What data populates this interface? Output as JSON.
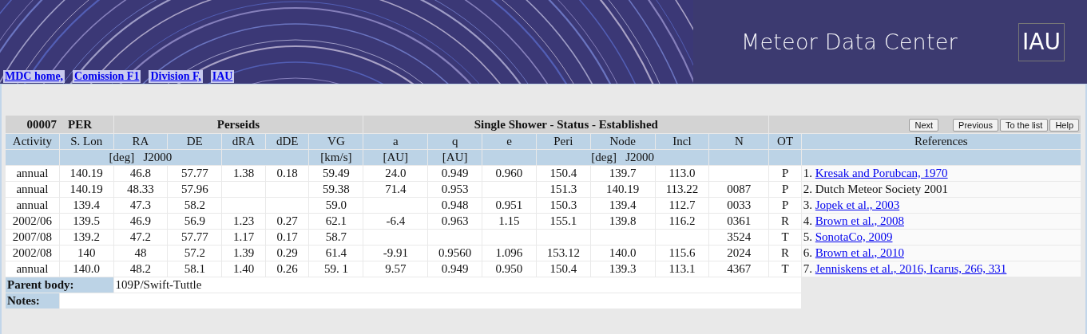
{
  "header": {
    "title": "Meteor Data Center",
    "logo": "IAU",
    "nav_links": [
      "MDC home,",
      "Comission F1",
      "Division F,",
      "IAU"
    ]
  },
  "shower": {
    "number": "00007",
    "code": "PER",
    "name": "Perseids",
    "status": "Single Shower - Status - Established"
  },
  "buttons": [
    "Next",
    "Previous",
    "To the list",
    "Help"
  ],
  "columns": [
    "Activity",
    "S. Lon",
    "RA",
    "DE",
    "dRA",
    "dDE",
    "VG",
    "a",
    "q",
    "e",
    "Peri",
    "Node",
    "Incl",
    "N",
    "OT",
    "References"
  ],
  "units": {
    "radiant": "[deg]   J2000",
    "vg": "[km/s]",
    "a": "[AU]",
    "q": "[AU]",
    "angles": "[deg]   J2000"
  },
  "rows": [
    {
      "cells": [
        "annual",
        "140.19",
        "46.8",
        "57.77",
        "1.38",
        "0.18",
        "59.49",
        "24.0",
        "0.949",
        "0.960",
        "150.4",
        "139.7",
        "113.0",
        null,
        "P"
      ],
      "reference": {
        "number": "1.",
        "text": "Kresak and Porubcan, 1970",
        "link": true
      }
    },
    {
      "cells": [
        "annual",
        "140.19",
        "48.33",
        "57.96",
        null,
        null,
        "59.38",
        "71.4",
        "0.953",
        null,
        "151.3",
        "140.19",
        "113.22",
        "0087",
        "P"
      ],
      "reference": {
        "number": "2.",
        "text": "Dutch Meteor Society 2001",
        "link": false
      }
    },
    {
      "cells": [
        "annual",
        "139.4",
        "47.3",
        "58.2",
        null,
        null,
        "59.0",
        null,
        "0.948",
        "0.951",
        "150.3",
        "139.4",
        "112.7",
        "0033",
        "P"
      ],
      "reference": {
        "number": "3.",
        "text": "Jopek et al., 2003",
        "link": true
      }
    },
    {
      "cells": [
        "2002/06",
        "139.5",
        "46.9",
        "56.9",
        "1.23",
        "0.27",
        "62.1",
        "-6.4",
        "0.963",
        "1.15",
        "155.1",
        "139.8",
        "116.2",
        "0361",
        "R"
      ],
      "reference": {
        "number": "4.",
        "text": "Brown et al., 2008",
        "link": true
      }
    },
    {
      "cells": [
        "2007/08",
        "139.2",
        "47.2",
        "57.77",
        "1.17",
        "0.17",
        "58.7",
        null,
        null,
        null,
        null,
        null,
        null,
        "3524",
        "T"
      ],
      "reference": {
        "number": "5.",
        "text": "SonotaCo, 2009",
        "link": true
      }
    },
    {
      "cells": [
        "2002/08",
        "140",
        "48",
        "57.2",
        "1.39",
        "0.29",
        "61.4",
        "-9.91",
        "0.9560",
        "1.096",
        "153.12",
        "140.0",
        "115.6",
        "2024",
        "R"
      ],
      "reference": {
        "number": "6.",
        "text": "Brown et al., 2010",
        "link": true
      }
    },
    {
      "cells": [
        "annual",
        "140.0",
        "48.2",
        "58.1",
        "1.40",
        "0.26",
        "59. 1",
        "9.57",
        "0.949",
        "0.950",
        "150.4",
        "139.3",
        "113.1",
        "4367",
        "T"
      ],
      "reference": {
        "number": "7.",
        "text": "Jenniskens et al., 2016, Icarus, 266, 331",
        "link": true
      }
    }
  ],
  "parent_body": {
    "label": "Parent body:",
    "value": "109P/Swift-Tuttle"
  },
  "notes": {
    "label": "Notes:"
  }
}
